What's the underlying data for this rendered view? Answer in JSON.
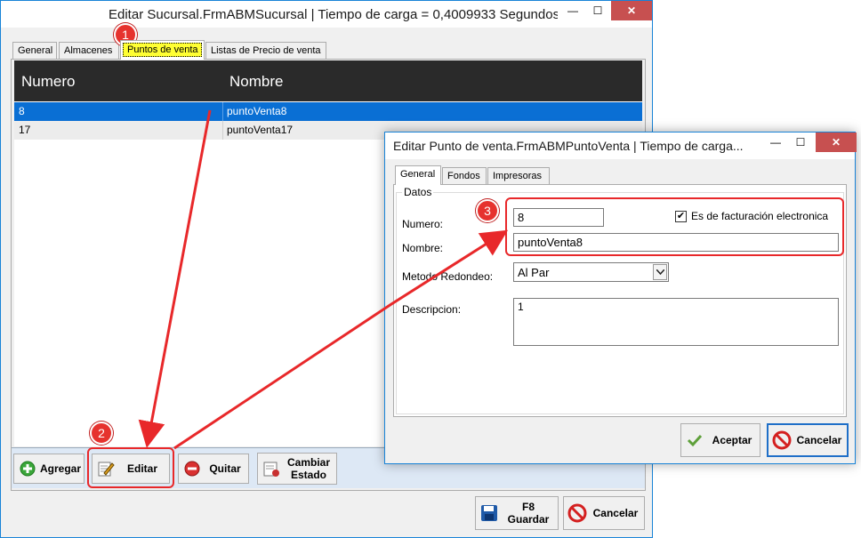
{
  "main_window": {
    "title": "Editar Sucursal.FrmABMSucursal | Tiempo de carga = 0,4009933 Segundos",
    "controls": {
      "minimize": "—",
      "maximize": "☐",
      "close": "✕"
    },
    "tabs": [
      {
        "label": "General"
      },
      {
        "label": "Almacenes"
      },
      {
        "label": "Puntos de venta"
      },
      {
        "label": "Listas de Precio de venta"
      }
    ],
    "grid": {
      "columns": [
        "Numero",
        "Nombre"
      ],
      "rows": [
        {
          "numero": "8",
          "nombre": "puntoVenta8"
        },
        {
          "numero": "17",
          "nombre": "puntoVenta17"
        }
      ]
    },
    "buttons": {
      "agregar": "Agregar",
      "editar": "Editar",
      "quitar": "Quitar",
      "cambiar_estado_l1": "Cambiar",
      "cambiar_estado_l2": "Estado",
      "guardar_l1": "F8",
      "guardar_l2": "Guardar",
      "cancelar": "Cancelar"
    }
  },
  "dialog": {
    "title": "Editar Punto de venta.FrmABMPuntoVenta | Tiempo de carga...",
    "controls": {
      "minimize": "—",
      "maximize": "☐",
      "close": "✕"
    },
    "tabs": [
      {
        "label": "General"
      },
      {
        "label": "Fondos"
      },
      {
        "label": "Impresoras"
      }
    ],
    "group_label": "Datos",
    "labels": {
      "numero": "Numero:",
      "nombre": "Nombre:",
      "metodo": "Metodo Redondeo:",
      "descripcion": "Descripcion:"
    },
    "values": {
      "numero": "8",
      "nombre": "puntoVenta8",
      "metodo": "Al Par",
      "descripcion": "1"
    },
    "checkbox": {
      "label": "Es de facturación electronica",
      "checked": true
    },
    "buttons": {
      "aceptar": "Aceptar",
      "cancelar": "Cancelar"
    }
  },
  "annotations": {
    "badge1": "1",
    "badge2": "2",
    "badge3": "3"
  },
  "colors": {
    "accent": "#1883d7",
    "selection": "#0a6fd4",
    "annotation_red": "#e8282a",
    "highlight_yellow": "#ffff33"
  }
}
